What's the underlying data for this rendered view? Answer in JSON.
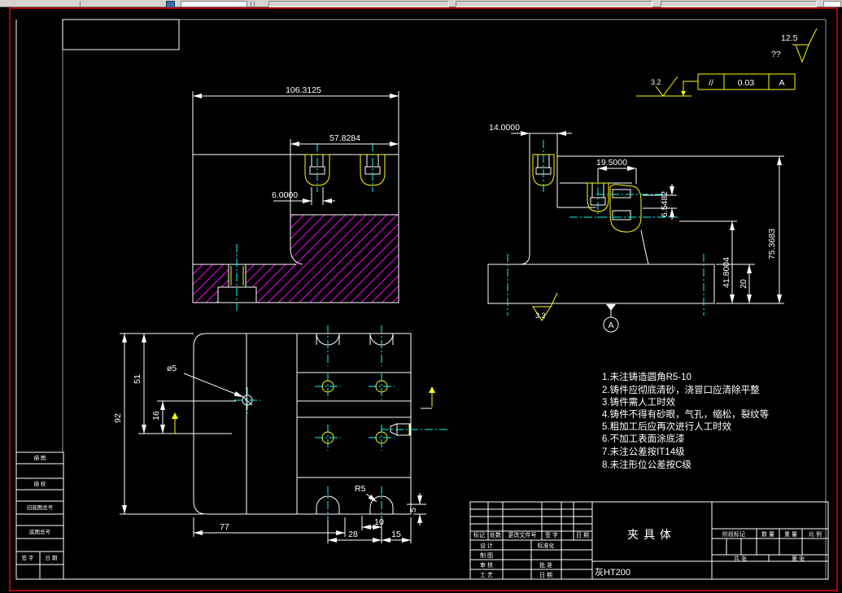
{
  "app": {
    "toolbar_note": "windows-toolbar-strip"
  },
  "marks": {
    "surface_top_prefix": "??",
    "surface_top": "12.5",
    "surface_upper": "3.2",
    "surface_bottom": "3.2",
    "fcf_symbol": "//",
    "fcf_tolerance": "0.03",
    "fcf_datum": "A",
    "datum_label": "A"
  },
  "front_view": {
    "dim_total_width": "106.3125",
    "dim_step_width": "57.8284",
    "dim_slot": "6.0000"
  },
  "side_view": {
    "dim_width": "14.0000",
    "dim_slot_span": "19.5000",
    "dim_thread": "6.5482",
    "dim_mid_height": "41.8004",
    "dim_total_height": "75.3683",
    "dim_base": "20"
  },
  "plan_view": {
    "dim_depth": "92",
    "dim_upper": "51",
    "dim_offset": "16",
    "dim_hole": "ø5",
    "dim_width": "77",
    "dim_pitch": "28",
    "dim_margin": "15",
    "dim_slot": "10",
    "dim_radius": "R5",
    "dim_edge": "5"
  },
  "notes": {
    "lines": [
      "1.未注铸造圆角R5-10",
      "2.铸件应彻底清砂，浇冒口应清除平整",
      "3.铸件需人工时效",
      "4.铸件不得有砂眼，气孔，缩松，裂纹等",
      "5.粗加工后应再次进行人工时效",
      "6.不加工表面涂底漆",
      "7.未注公差按IT14级",
      "8.未注形位公差按C级"
    ]
  },
  "title_block": {
    "name": "夹具体",
    "material": "灰HT200",
    "col_mark": "标记",
    "col_count": "处数",
    "col_doc": "更改文件号",
    "col_sign": "签 字",
    "col_date": "日 期",
    "row_design": "设 计",
    "row_draw": "制 图",
    "row_check": "审 核",
    "row_process": "工 艺",
    "lbl_standard": "标准化",
    "lbl_approve": "批 准",
    "lbl_date": "日 期",
    "lbl_stage": "阶段标记",
    "lbl_qty": "数 量",
    "lbl_weight": "重 量",
    "lbl_scale": "比 例",
    "lbl_total": "共  张",
    "lbl_page": "第  张"
  },
  "margin_table": {
    "r1": "描 图",
    "r2": "描 校",
    "r3": "旧底图总号",
    "r4": "底图总号",
    "r5": "签 字",
    "r6": "日 期"
  },
  "colors": {
    "line": "#ffffff",
    "hatch": "#ff00ff",
    "centerline": "#00ffff",
    "accent": "#ffff00",
    "border": "#ff0000",
    "toolbar": "#d6d3ce"
  }
}
